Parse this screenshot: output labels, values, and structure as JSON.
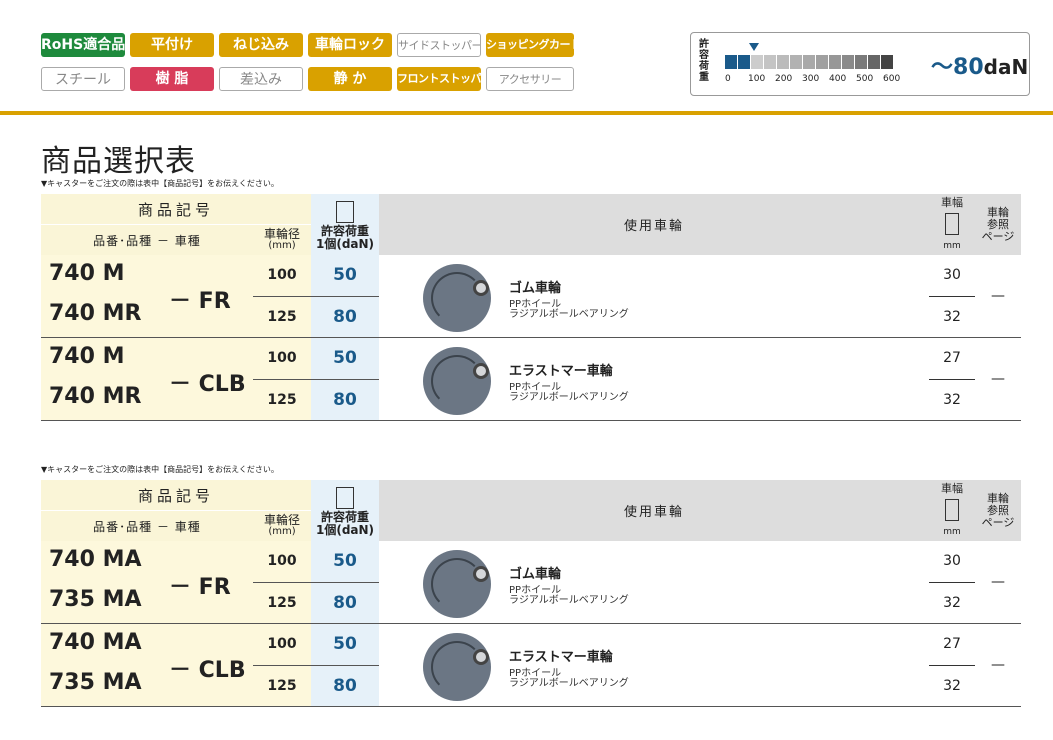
{
  "tags": {
    "row1": [
      "RoHS適合品",
      "平付け",
      "ねじ込み",
      "車輪ロック",
      "サイドストッパー",
      "ショッピングカート"
    ],
    "row2": [
      "スチール",
      "樹 脂",
      "差込み",
      "静 か",
      "フロントストッパー",
      "アクセサリー"
    ]
  },
  "load_box": {
    "title": "許容荷重",
    "ticks": [
      "0",
      "100",
      "200",
      "300",
      "400",
      "500",
      "600"
    ],
    "max_prefix": "〜",
    "max_value": "80",
    "max_unit": "daN",
    "level_daN": 80
  },
  "page_title": "商品選択表",
  "note": "▼キャスターをご注文の際は表中【商品記号】をお伝えください。",
  "headers": {
    "code": "商品記号",
    "code_sub": "品番･品種 － 車種",
    "dia": "車輪径",
    "dia_unit": "(mm)",
    "load_line1": "許容荷重",
    "load_line2": "1個(daN)",
    "wheel": "使用車輪",
    "width": "車幅",
    "width_unit": "mm",
    "ref_line1": "車輪",
    "ref_line2": "参照",
    "ref_line3": "ページ"
  },
  "tables": [
    {
      "groups": [
        {
          "codes": [
            "740 M",
            "740 MR"
          ],
          "suffix": "－ FR",
          "rows": [
            {
              "dia": "100",
              "load": "50",
              "width": "30"
            },
            {
              "dia": "125",
              "load": "80",
              "width": "32"
            }
          ],
          "wheel_name": "ゴム車輪",
          "wheel_d1": "PPホイール",
          "wheel_d2": "ラジアルボールベアリング",
          "ref": "—"
        },
        {
          "codes": [
            "740 M",
            "740 MR"
          ],
          "suffix": "－ CLB",
          "rows": [
            {
              "dia": "100",
              "load": "50",
              "width": "27"
            },
            {
              "dia": "125",
              "load": "80",
              "width": "32"
            }
          ],
          "wheel_name": "エラストマー車輪",
          "wheel_d1": "PPホイール",
          "wheel_d2": "ラジアルボールベアリング",
          "ref": "—"
        }
      ]
    },
    {
      "groups": [
        {
          "codes": [
            "740 MA",
            "735 MA"
          ],
          "suffix": "－ FR",
          "rows": [
            {
              "dia": "100",
              "load": "50",
              "width": "30"
            },
            {
              "dia": "125",
              "load": "80",
              "width": "32"
            }
          ],
          "wheel_name": "ゴム車輪",
          "wheel_d1": "PPホイール",
          "wheel_d2": "ラジアルボールベアリング",
          "ref": "—"
        },
        {
          "codes": [
            "740 MA",
            "735 MA"
          ],
          "suffix": "－ CLB",
          "rows": [
            {
              "dia": "100",
              "load": "50",
              "width": "27"
            },
            {
              "dia": "125",
              "load": "80",
              "width": "32"
            }
          ],
          "wheel_name": "エラストマー車輪",
          "wheel_d1": "PPホイール",
          "wheel_d2": "ラジアルボールベアリング",
          "ref": "—"
        }
      ]
    }
  ],
  "colors": {
    "gold": "#d9a100",
    "blue": "#1a5a8a",
    "green": "#1e8a3c",
    "red": "#d83c5a"
  }
}
